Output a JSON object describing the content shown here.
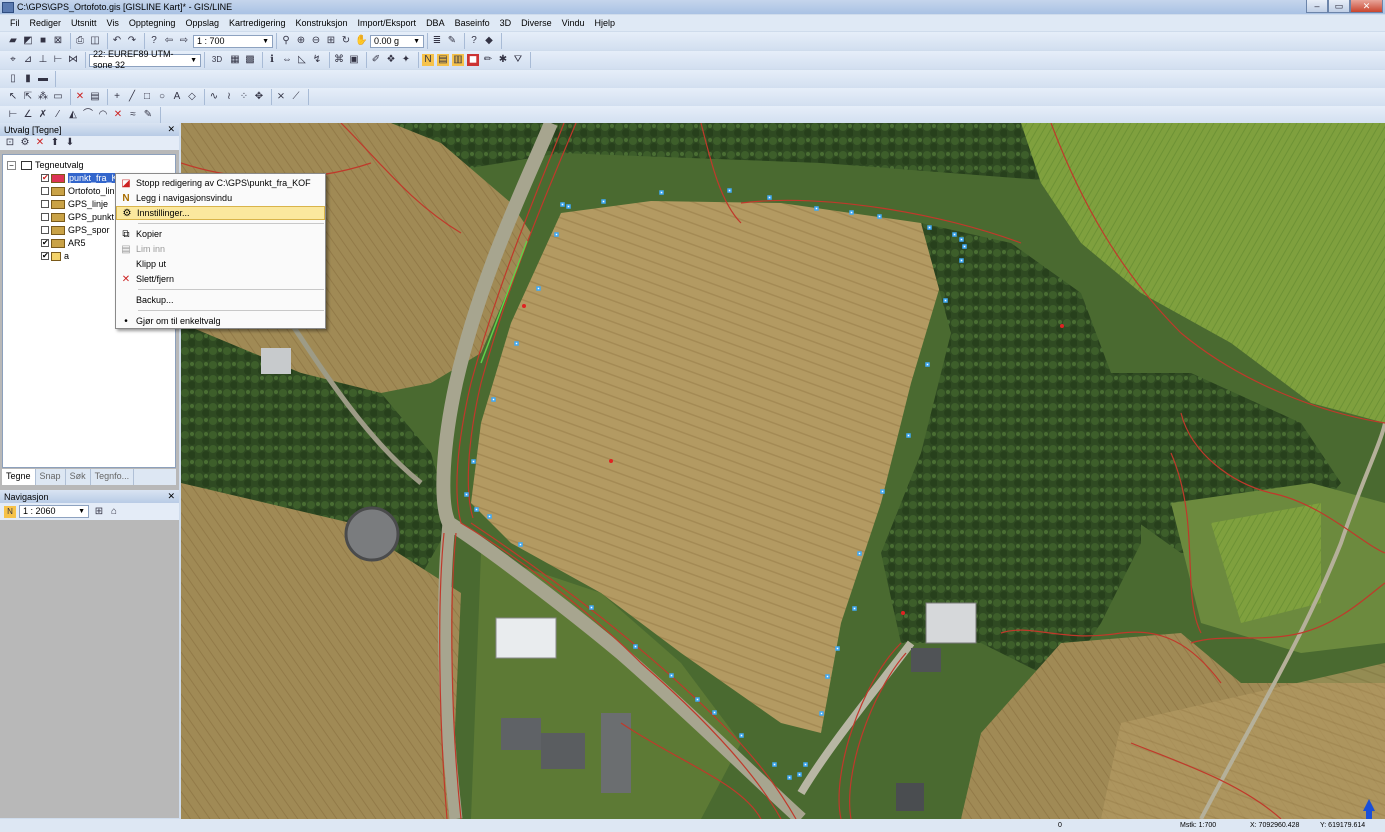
{
  "window": {
    "title": "C:\\GPS\\GPS_Ortofoto.gis [GISLINE Kart]* - GIS/LINE",
    "buttons": [
      "–",
      "▭",
      "✕"
    ]
  },
  "menu": [
    "Fil",
    "Rediger",
    "Utsnitt",
    "Vis",
    "Opptegning",
    "Oppslag",
    "Kartredigering",
    "Konstruksjon",
    "Import/Eksport",
    "DBA",
    "Baseinfo",
    "3D",
    "Diverse",
    "Vindu",
    "Hjelp"
  ],
  "toolbar": {
    "scale_value": "1 : 700",
    "angle_value": "0.00 g",
    "crs_value": "22: EUREF89 UTM-sone 32",
    "snap_value": "3D"
  },
  "layers_panel": {
    "title": "Utvalg [Tegne]",
    "root": "Tegneutvalg",
    "items": [
      {
        "label": "punkt_fra_KOF",
        "checked": true
      },
      {
        "label": "Ortofoto_lin",
        "checked": false
      },
      {
        "label": "GPS_linje",
        "checked": false
      },
      {
        "label": "GPS_punkt",
        "checked": false
      },
      {
        "label": "GPS_spor",
        "checked": false
      },
      {
        "label": "AR5",
        "checked": true
      },
      {
        "label": "a",
        "checked": true
      }
    ],
    "tabs": [
      "Tegne",
      "Snap",
      "Søk",
      "Tegnfo..."
    ]
  },
  "nav_panel": {
    "title": "Navigasjon",
    "scale_value": "1 : 2060"
  },
  "context_menu": {
    "items": [
      {
        "label": "Stopp redigering av C:\\GPS\\punkt_fra_KOF",
        "icon": "edit-layer-icon",
        "enabled": true
      },
      {
        "label": "Legg i navigasjonsvindu",
        "icon": "navigation-n-icon",
        "enabled": true
      },
      {
        "label": "Innstillinger...",
        "icon": "settings-icon",
        "enabled": true,
        "highlighted": true
      },
      {
        "label": "Kopier",
        "icon": "copy-icon",
        "enabled": true
      },
      {
        "label": "Lim inn",
        "icon": "paste-icon",
        "enabled": false
      },
      {
        "label": "Klipp ut",
        "icon": "",
        "enabled": true
      },
      {
        "label": "Slett/fjern",
        "icon": "delete-x-icon",
        "enabled": true
      },
      {
        "label": "Backup...",
        "icon": "",
        "enabled": true
      },
      {
        "label": "Gjør om til enkeltvalg",
        "icon": "bullet-icon",
        "enabled": true
      }
    ]
  },
  "status": {
    "indicator": "0",
    "mstk": "Mstk: 1:700",
    "x": "X: 7092960.428",
    "y": "Y: 619179.614"
  },
  "colors": {
    "accent_highlight": "#fbe89e",
    "property_line": "#c0392b",
    "point_marker": "#3fa9f5",
    "title_bar": "#b8cbe6"
  }
}
